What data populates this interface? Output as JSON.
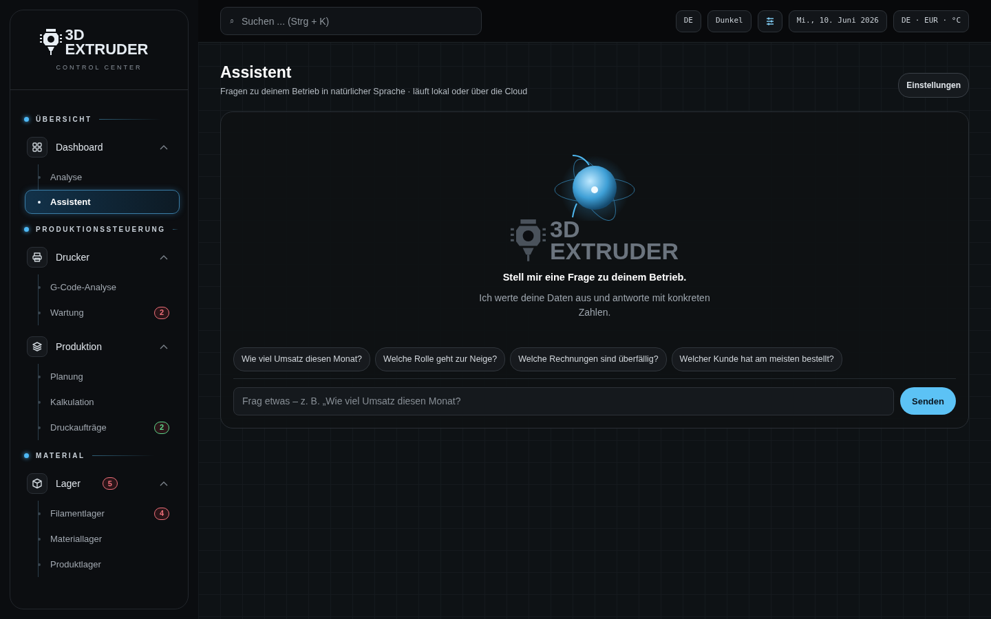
{
  "sidebar": {
    "logo": {
      "line1": "3D",
      "line2": "EXTRUDER",
      "subtitle": "CONTROL CENTER"
    },
    "sections": [
      {
        "title": "ÜBERSICHT",
        "groups": [
          {
            "label": "Dashboard",
            "expanded": true,
            "children": [
              {
                "label": "Analyse",
                "selected": false
              },
              {
                "label": "Assistent",
                "selected": true
              }
            ]
          }
        ]
      },
      {
        "title": "PRODUKTIONSSTEUERUNG",
        "groups": [
          {
            "label": "Drucker",
            "expanded": true,
            "children": [
              {
                "label": "G-Code-Analyse",
                "selected": false
              },
              {
                "label": "Wartung",
                "selected": false,
                "badge": {
                  "text": "2",
                  "color": "#f0707a"
                }
              }
            ]
          },
          {
            "label": "Produktion",
            "expanded": true,
            "children": [
              {
                "label": "Planung",
                "selected": false
              },
              {
                "label": "Kalkulation",
                "selected": false
              },
              {
                "label": "Druckaufträge",
                "selected": false,
                "badge": {
                  "text": "2",
                  "color": "#5ed68a"
                }
              }
            ]
          }
        ]
      },
      {
        "title": "MATERIAL",
        "groups": [
          {
            "label": "Lager",
            "expanded": true,
            "badge": {
              "text": "5",
              "color": "#f0707a"
            },
            "children": [
              {
                "label": "Filamentlager",
                "selected": false,
                "badge": {
                  "text": "4",
                  "color": "#f0707a"
                }
              },
              {
                "label": "Materiallager",
                "selected": false
              },
              {
                "label": "Produktlager",
                "selected": false
              }
            ]
          }
        ]
      }
    ]
  },
  "topbar": {
    "search": {
      "icon": "⌕",
      "placeholder": "Suchen ... (Strg + K)"
    },
    "pills": [
      {
        "kind": "text",
        "label": "DE"
      },
      {
        "kind": "text",
        "label": "Dunkel"
      },
      {
        "kind": "icon"
      },
      {
        "kind": "text",
        "label": "Mi., 10. Juni 2026"
      },
      {
        "kind": "text",
        "label": "DE · EUR · °C"
      }
    ]
  },
  "page": {
    "title": "Assistent",
    "subtitle": "Fragen zu deinem Betrieb in natürlicher Sprache · läuft lokal oder über die Cloud",
    "settings_button": "Einstellungen"
  },
  "chat": {
    "watermark": {
      "line1": "3D",
      "line2": "EXTRUDER"
    },
    "heading": "Stell mir eine Frage zu deinem Betrieb.",
    "text": "Ich werte deine Daten aus und antworte mit konkreten Zahlen.",
    "suggestions": [
      "Wie viel Umsatz diesen Monat?",
      "Welche Rolle geht zur Neige?",
      "Welche Rechnungen sind überfällig?",
      "Welcher Kunde hat am meisten bestellt?"
    ],
    "input": {
      "placeholder": "Frag etwas – z. B. „Wie viel Umsatz diesen Monat?"
    },
    "send_button": "Senden"
  }
}
